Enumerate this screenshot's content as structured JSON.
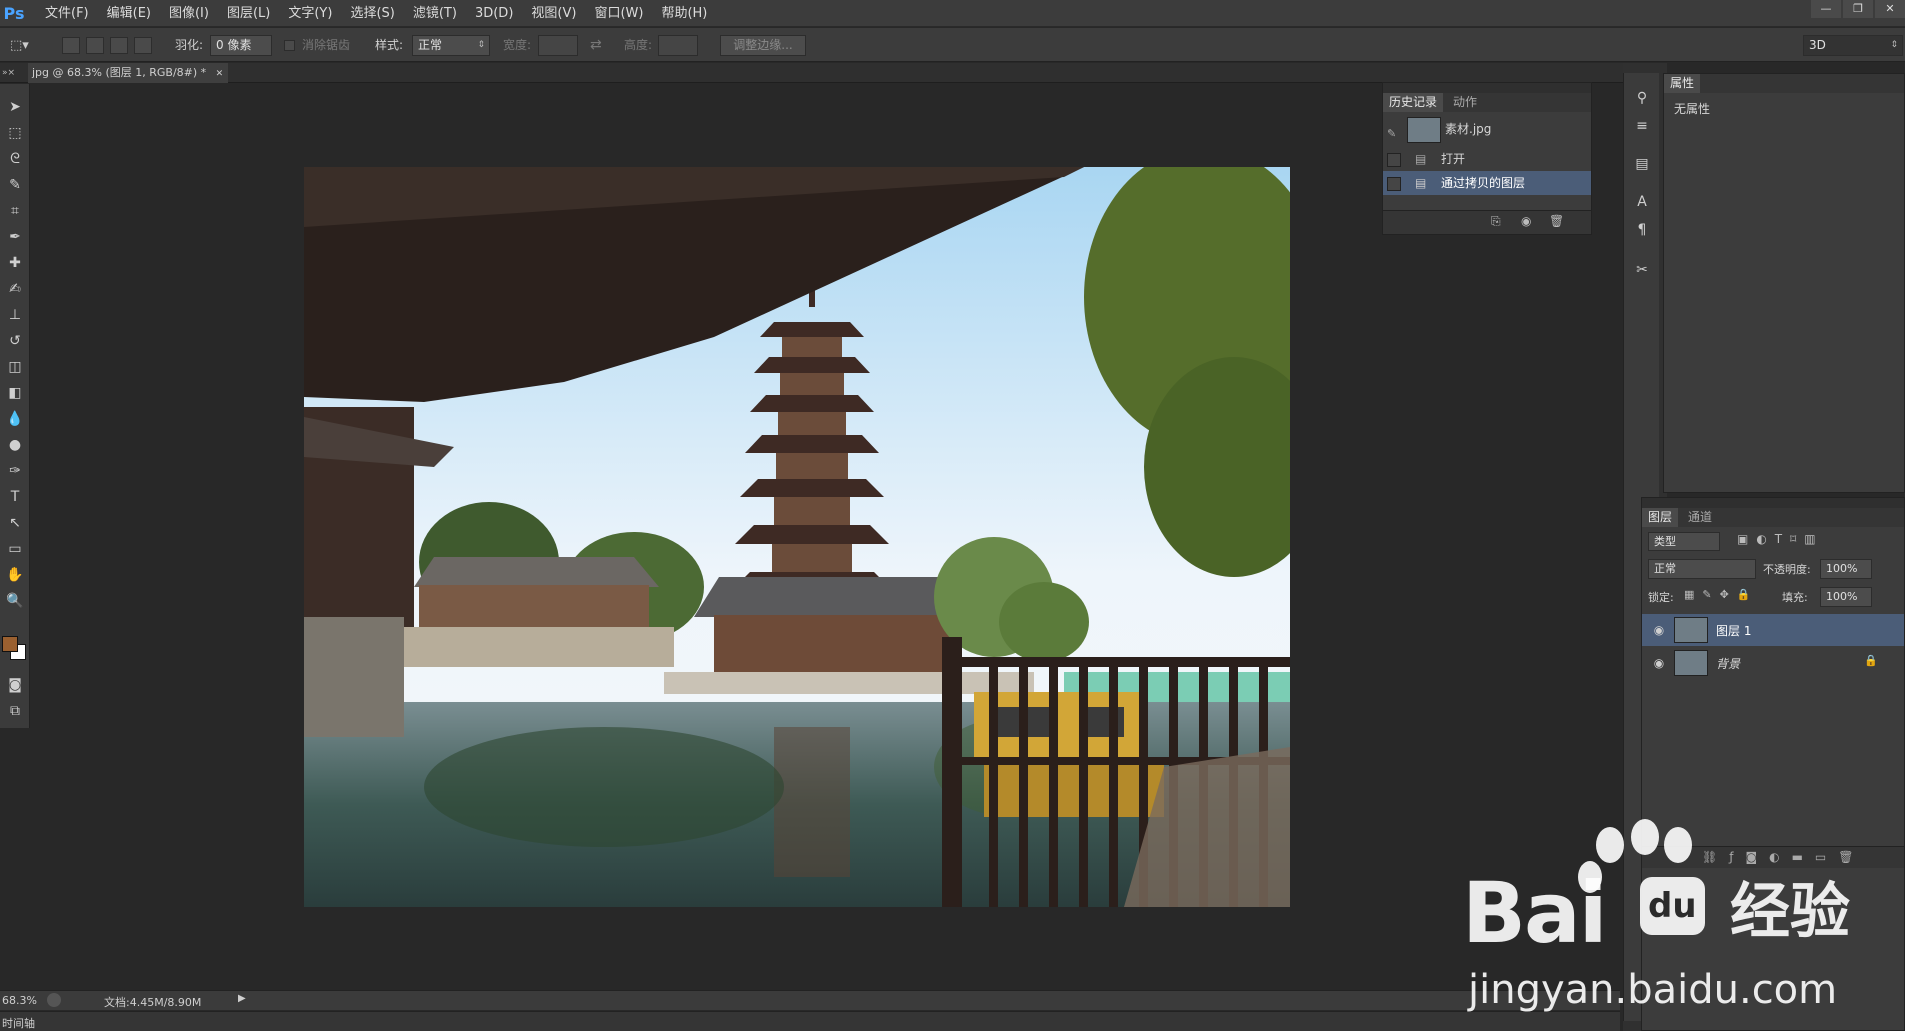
{
  "app": {
    "logo": "Ps",
    "menus": [
      "文件(F)",
      "编辑(E)",
      "图像(I)",
      "图层(L)",
      "文字(Y)",
      "选择(S)",
      "滤镜(T)",
      "3D(D)",
      "视图(V)",
      "窗口(W)",
      "帮助(H)"
    ],
    "window_controls": [
      "—",
      "❐",
      "✕"
    ]
  },
  "options": {
    "feather_label": "羽化:",
    "feather_value": "0 像素",
    "antialias_label": "消除锯齿",
    "style_label": "样式:",
    "style_value": "正常",
    "width_label": "宽度:",
    "height_label": "高度:",
    "refine_button": "调整边缘...",
    "workspace_value": "3D"
  },
  "document": {
    "tab_title": "jpg @ 68.3% (图层 1, RGB/8#) *",
    "tab_close": "✕"
  },
  "status": {
    "zoom": "68.3%",
    "doc_info": "文档:4.45M/8.90M"
  },
  "timeline": {
    "label": "时间轴"
  },
  "history_panel": {
    "tabs": [
      "历史记录",
      "动作"
    ],
    "snapshot": "素材.jpg",
    "items": [
      "打开",
      "通过拷贝的图层"
    ],
    "selected_index": 1
  },
  "properties_panel": {
    "tab": "属性",
    "content": "无属性"
  },
  "layers_panel": {
    "tabs": [
      "图层",
      "通道"
    ],
    "filter_kind": "类型",
    "blend_mode": "正常",
    "opacity_label": "不透明度:",
    "opacity_value": "100%",
    "lock_label": "锁定:",
    "fill_label": "填充:",
    "fill_value": "100%",
    "layers": [
      {
        "name": "图层 1",
        "selected": true,
        "locked": false
      },
      {
        "name": "背景",
        "selected": false,
        "locked": true
      }
    ]
  },
  "watermark": {
    "brand": "Bai",
    "brand2": "经验",
    "url": "jingyan.baidu.com"
  },
  "colors": {
    "accent_selected": "#4b5d78",
    "foreground_swatch": "#9a6030",
    "background_swatch": "#ffffff"
  }
}
